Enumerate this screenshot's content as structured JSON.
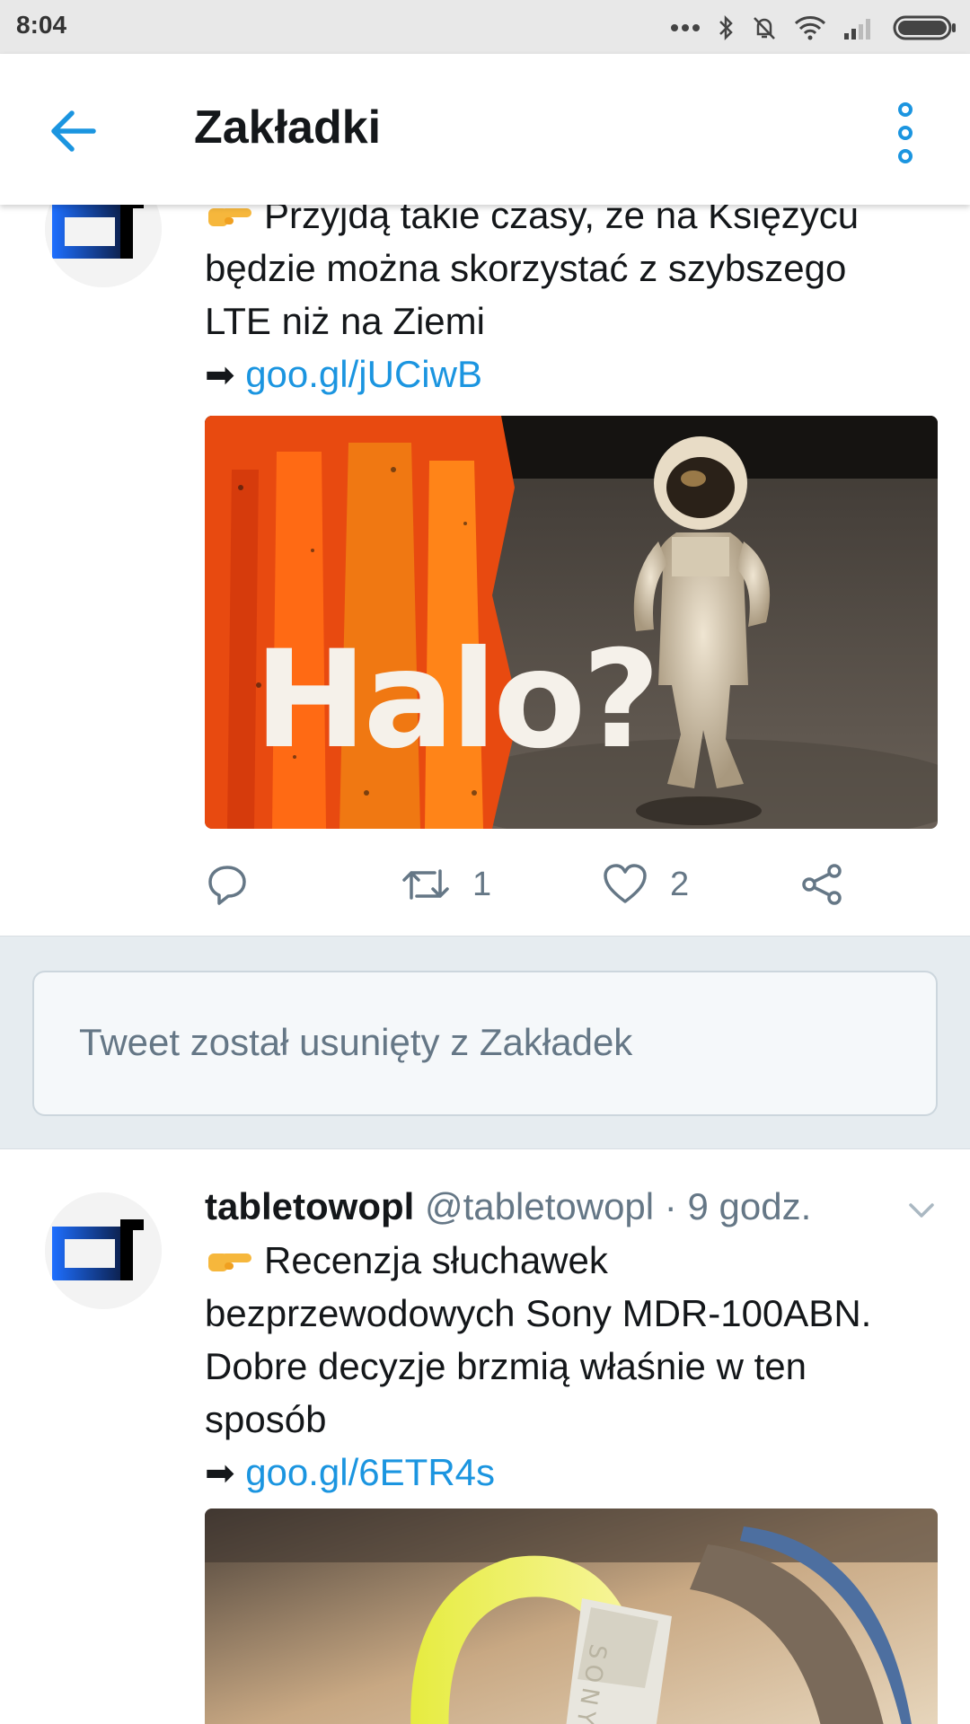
{
  "status_bar": {
    "time": "8:04",
    "icons": [
      "dots-icon",
      "bluetooth-icon",
      "bell-off-icon",
      "wifi-icon",
      "signal-icon",
      "battery-icon"
    ]
  },
  "header": {
    "title": "Zakładki",
    "back_icon": "arrow-left-icon",
    "menu_icon": "overflow-menu-icon"
  },
  "tweets": [
    {
      "text_lines": [
        "Przyjdą takie czasy, że na Księżycu",
        "będzie można skorzystać z szybszego",
        "LTE niż na Ziemi"
      ],
      "link_prefix": "➡",
      "link": "goo.gl/jUCiwB",
      "media_caption": "Halo?",
      "actions": {
        "reply_count": "",
        "retweet_count": "1",
        "like_count": "2"
      }
    },
    {
      "name": "tabletowopl",
      "handle": "@tabletowopl",
      "separator": "·",
      "time": "9 godz.",
      "text_lines": [
        "Recenzja słuchawek",
        "bezprzewodowych Sony MDR-100ABN.",
        "Dobre decyzje brzmią właśnie w ten",
        "sposób"
      ],
      "link_prefix": "➡",
      "link": "goo.gl/6ETR4s",
      "media_brand": "SONY"
    }
  ],
  "removed_notice": "Tweet został usunięty z Zakładek",
  "colors": {
    "accent": "#1b95e0",
    "text": "#14171a",
    "muted": "#657786",
    "band": "#e6ecf0",
    "avatar_blue": "#1e6fff"
  }
}
